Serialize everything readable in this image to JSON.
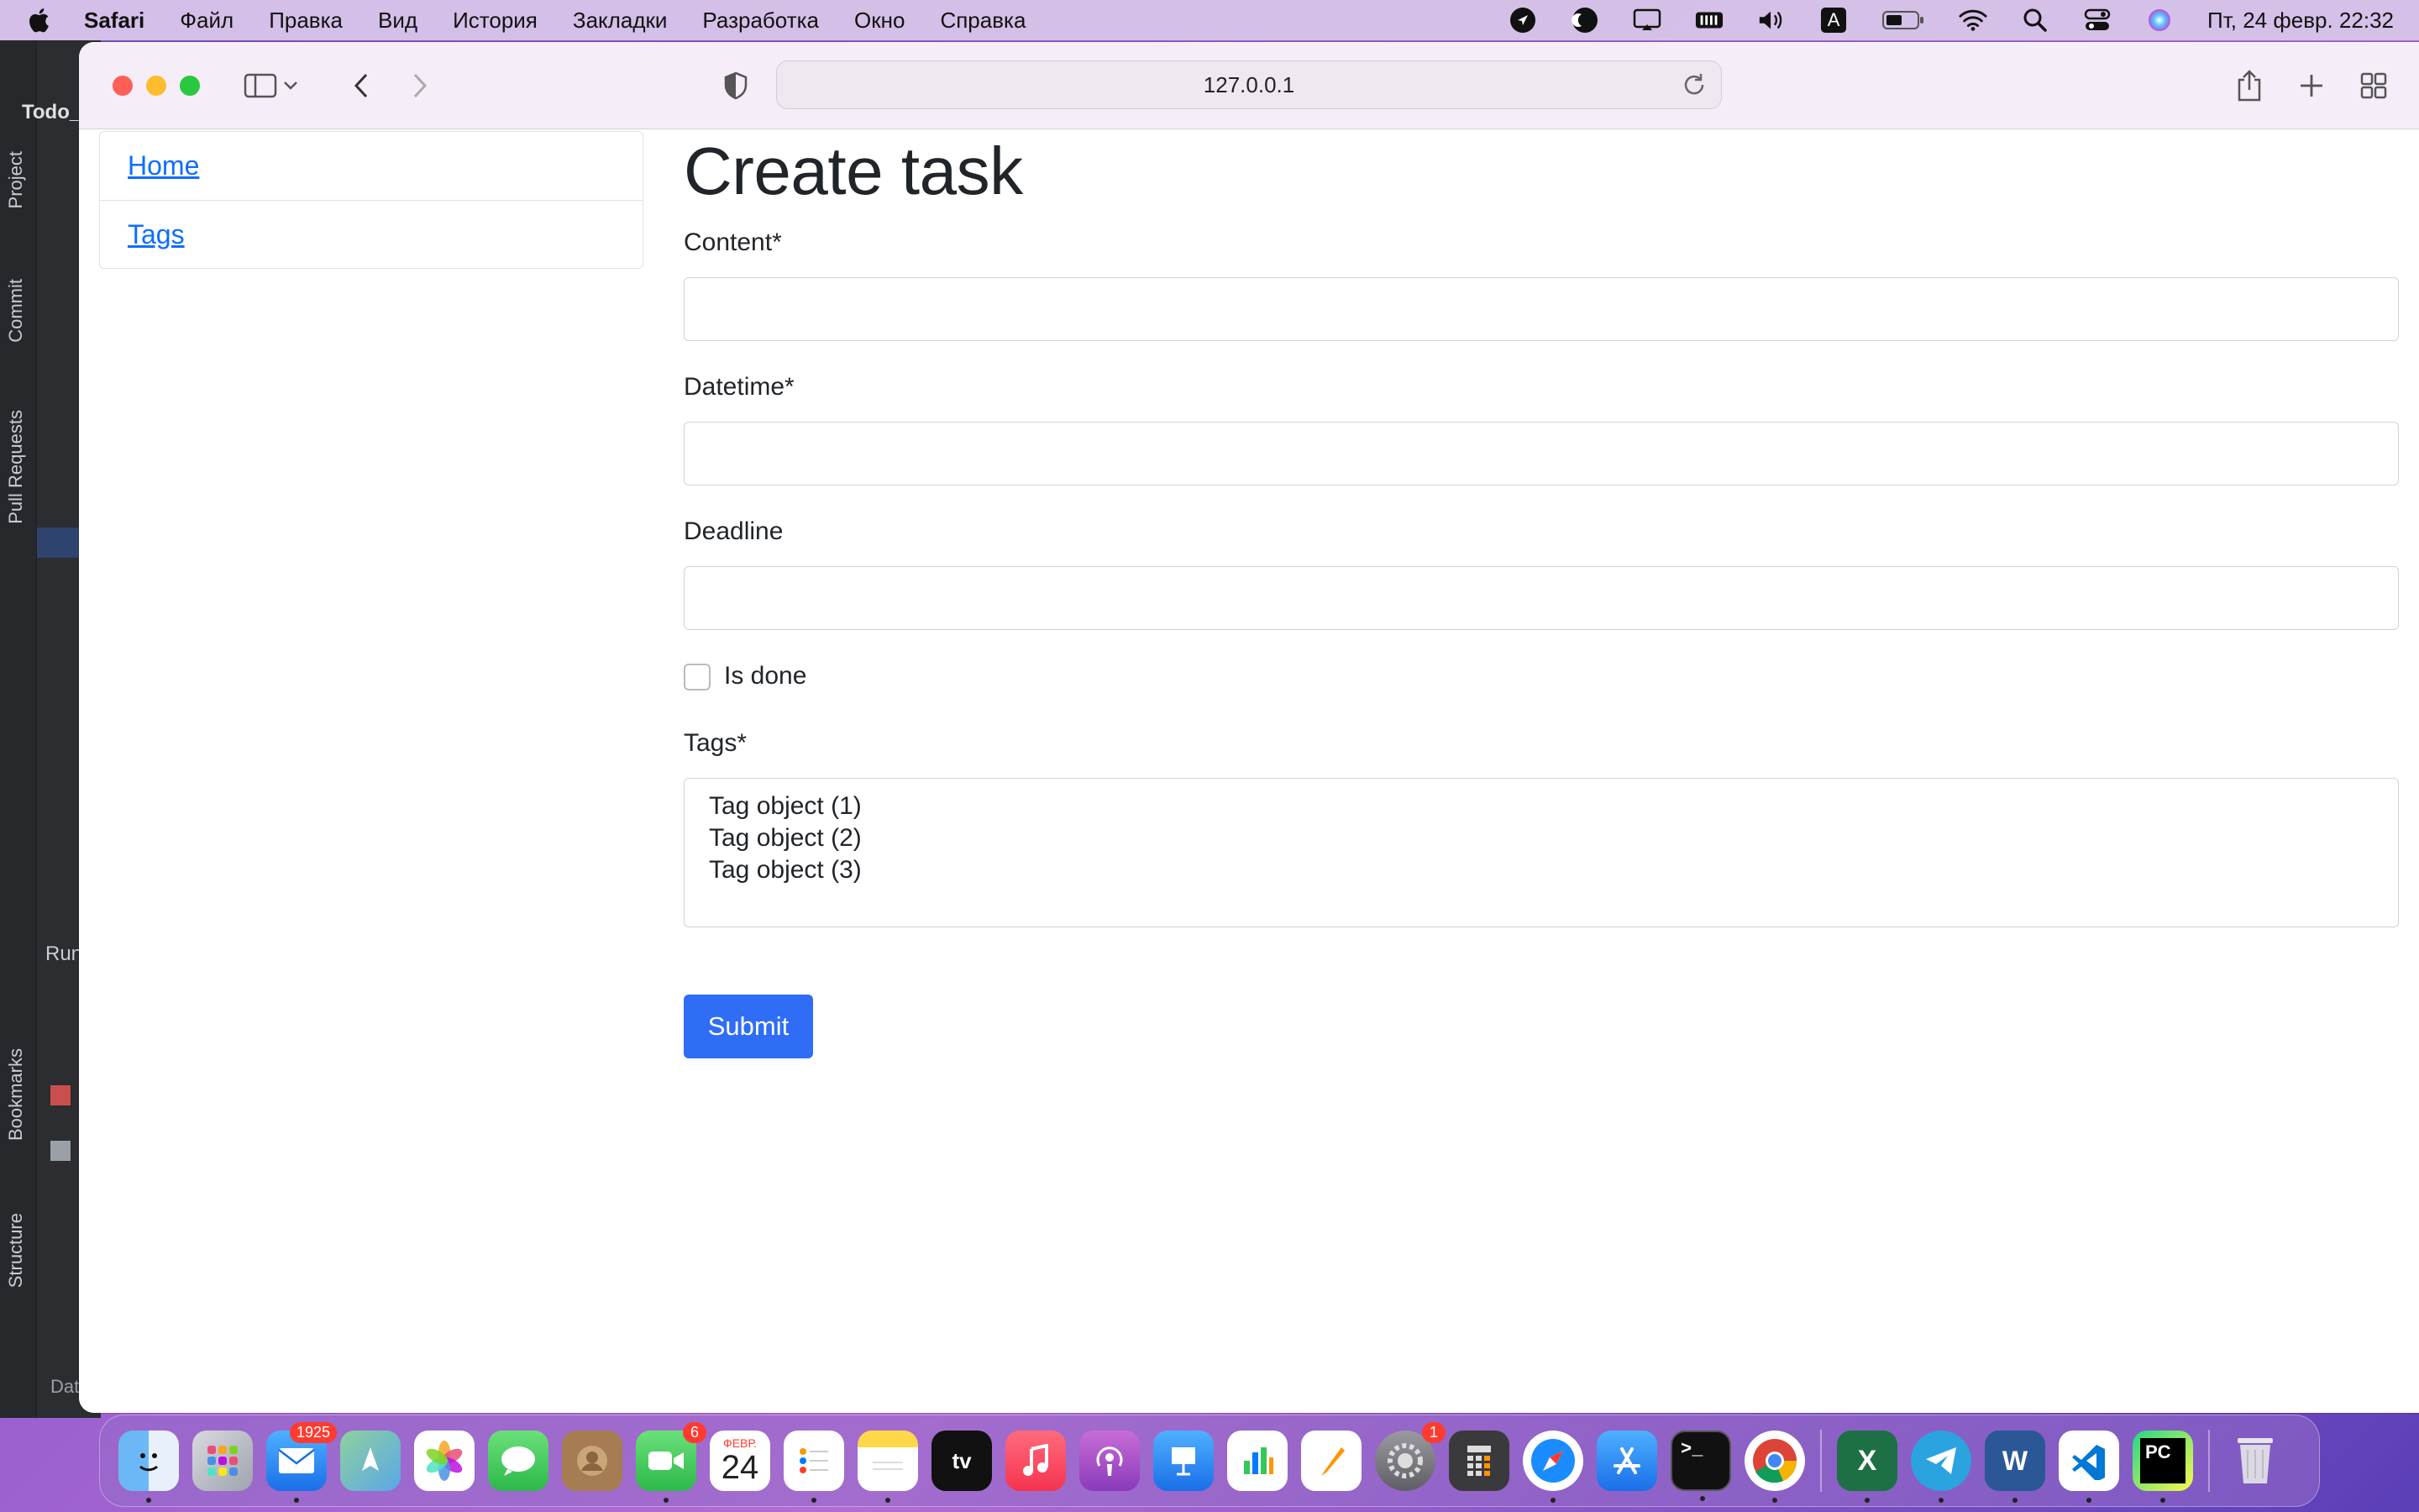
{
  "menubar": {
    "app_name": "Safari",
    "items": [
      "Файл",
      "Правка",
      "Вид",
      "История",
      "Закладки",
      "Разработка",
      "Окно",
      "Справка"
    ],
    "input_source": "A",
    "clock": "Пт, 24 февр.  22:32"
  },
  "ide": {
    "project_title": "Todo_",
    "tabs": [
      "Project",
      "Commit",
      "Pull Requests",
      "Bookmarks",
      "Structure"
    ],
    "run_label": "Run",
    "bottom_label": "Dat"
  },
  "browser": {
    "url": "127.0.0.1"
  },
  "sidebar": {
    "links": [
      "Home",
      "Tags"
    ]
  },
  "form": {
    "title": "Create task",
    "content_label": "Content*",
    "datetime_label": "Datetime*",
    "deadline_label": "Deadline",
    "is_done_label": "Is done",
    "tags_label": "Tags*",
    "tag_options": [
      "Tag object (1)",
      "Tag object (2)",
      "Tag object (3)"
    ],
    "submit_label": "Submit"
  },
  "dock": {
    "mail_badge": "1925",
    "facetime_badge": "6",
    "calendar_month": "ФЕВР.",
    "calendar_day": "24",
    "settings_badge": "1",
    "tv_label": "tv",
    "terminal_label": ">_",
    "excel_label": "X",
    "word_label": "W",
    "pycharm_label": "PC"
  },
  "colors": {
    "link": "#0d6efd",
    "primary_button": "#2f6df6",
    "ide_background": "#2b2d30"
  }
}
